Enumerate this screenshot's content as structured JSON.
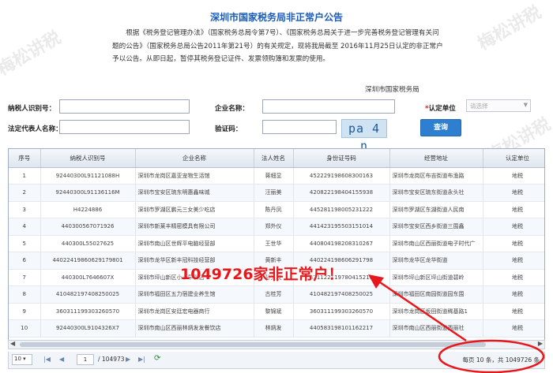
{
  "notice": {
    "title": "深圳市国家税务局非正常户公告",
    "body": "根据《税务登记管理办法》（国家税务总局令第7号）、《国家税务总局关于进一步完善税务登记管理有关问题的公告》（国家税务总局公告2011年第21号）的有关规定，现将我局截至 2016年11月25日认定的非正常户予以公告。从即日起，暂停其税务登记证件、发票领购簿和发票的使用。",
    "signature": "深圳市国家税务局"
  },
  "form": {
    "taxpayer_id_label": "纳税人识别号：",
    "company_name_label": "企业名称：",
    "determination_unit_label": "认定单位",
    "determination_unit_value": "请选择",
    "legal_rep_label": "法定代表人名称：",
    "captcha_label": "验证码：",
    "captcha_text": "pa 4 n",
    "query_button": "查询"
  },
  "table": {
    "columns": [
      "序号",
      "纳税人识别号",
      "企业名称",
      "法人姓名",
      "身份证号码",
      "经营地址",
      "认定单位"
    ],
    "rows": [
      [
        "1",
        "92440300L91121088H",
        "深圳市龙岗区嘉亚宠物生活馆",
        "蒋细显",
        "452229198608300163",
        "深圳市龙岗区布吉街道布渔路",
        "地税"
      ],
      [
        "2",
        "92440300L91136116M",
        "深圳市宝安区琉东明惠鑫味城",
        "汪丽美",
        "420822198404155938",
        "深圳市宝安区琉东街道永头社",
        "地税"
      ],
      [
        "3",
        "H4224886",
        "深圳市罗湖区鹏元三女美少吃店",
        "陈丹凤",
        "445281198005231222",
        "深圳市罗湖区东湖街道人民南",
        "地税"
      ],
      [
        "4",
        "440300567071926",
        "深圳市新莱丰精密模具有限公司",
        "郑外仪",
        "441423195503151014",
        "深圳市宝安区西乡街道三围鑫",
        "地税"
      ],
      [
        "5",
        "440300L55027625",
        "深圳市南山区世辉平电脑经营部",
        "王世华",
        "440804198208310267",
        "深圳市南山区西丽街道电子时代广",
        "地税"
      ],
      [
        "6",
        "44022419860629179801",
        "深圳市龙华区新丰冠科技经营部",
        "黄新丰",
        "440224198606291798",
        "深圳市龙华区龙华街道",
        "地税"
      ],
      [
        "7",
        "440300L7646607X",
        "深圳市坪山新区小小早餐店",
        "孙光权",
        "421122119780415216",
        "深圳市坪山新区坪山街道碧岭",
        "地税"
      ],
      [
        "8",
        "410482197408250025",
        "深圳市福田区五力宿建业养生馆",
        "古桂芳",
        "410482197408250025",
        "深圳市福田区南园街道园东围",
        "地税"
      ],
      [
        "9",
        "360311199303260570",
        "深圳市龙岗区安廷宏电器商行",
        "黎锦斌",
        "360311199303260570",
        "深圳市龙岗区坂田街道稀基路1",
        "地税"
      ],
      [
        "10",
        "92440300L9104326X7",
        "深圳市南山区西丽林炳发发餐饮店",
        "林炳发",
        "440583198101162217",
        "深圳市南山区西丽街道西丽社",
        "地税"
      ]
    ]
  },
  "pager": {
    "page_size": "10",
    "current_page": "1",
    "total_pages": "/ 104973",
    "info": "每页 10 条，共 1049726 条"
  },
  "annotation": {
    "text": "1049726家非正常户！",
    "color": "#e8171c"
  },
  "watermark": {
    "text": "梅松讲税"
  },
  "colors": {
    "title": "#1a5bb8",
    "button": "#2f7fd1",
    "annotation": "#e8171c"
  }
}
